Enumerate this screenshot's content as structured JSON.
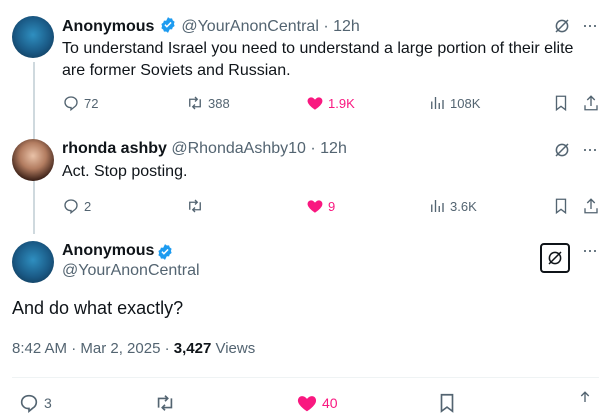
{
  "tweets": [
    {
      "name": "Anonymous",
      "handle": "@YourAnonCentral",
      "time": "12h",
      "text": "To understand Israel you need to understand a large portion of their elite are former Soviets and Russian.",
      "replies": "72",
      "retweets": "388",
      "likes": "1.9K",
      "views": "108K"
    },
    {
      "name": "rhonda ashby",
      "handle": "@RhondaAshby10",
      "time": "12h",
      "text": "Act. Stop posting.",
      "replies": "2",
      "retweets": "",
      "likes": "9",
      "views": "3.6K"
    }
  ],
  "main": {
    "name": "Anonymous",
    "handle": "@YourAnonCentral",
    "text": "And do what exactly?",
    "timestamp": "8:42 AM · Mar 2, 2025 · ",
    "views_count": "3,427",
    "views_label": " Views",
    "replies": "3",
    "likes": "40"
  },
  "separator": "·",
  "colors": {
    "verified": "#1d9bf0",
    "like": "#f91880",
    "muted": "#536471"
  }
}
